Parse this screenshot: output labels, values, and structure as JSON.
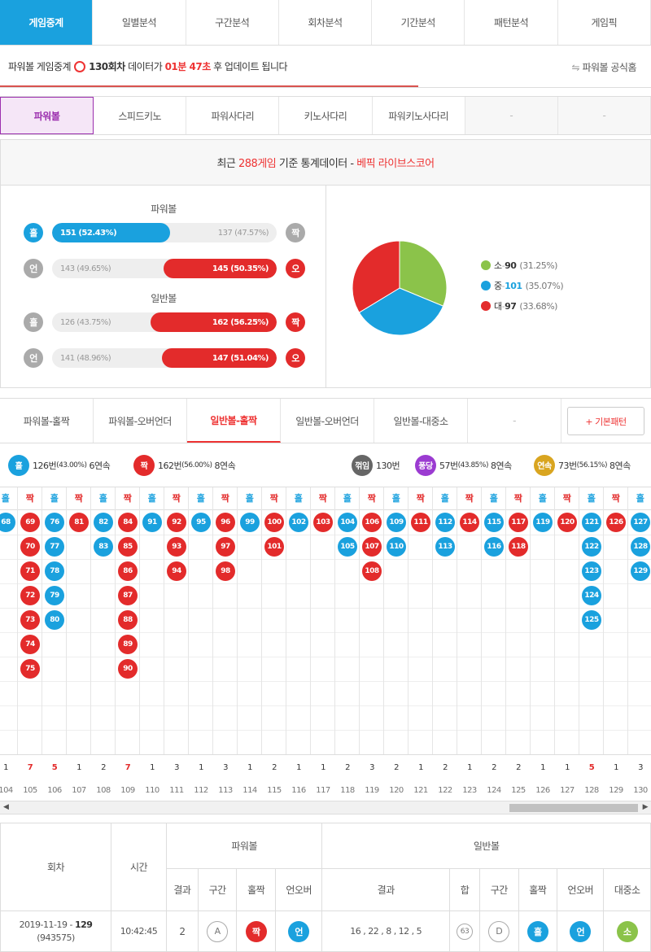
{
  "top_tabs": [
    "게임중계",
    "일별분석",
    "구간분석",
    "회차분석",
    "기간분석",
    "패턴분석",
    "게임픽"
  ],
  "info": {
    "prefix": "파워볼 게임중계",
    "round": "130회차",
    "mid": "데이터가",
    "time": "01분 47초",
    "suffix": "후 업데이트 됩니다",
    "official": "파워볼 공식홈"
  },
  "game_tabs": [
    "파워볼",
    "스피드키노",
    "파워사다리",
    "키노사다리",
    "파워키노사다리",
    "-",
    "-"
  ],
  "stats": {
    "head_prefix": "최근",
    "head_count": "288게임",
    "head_mid": "기준 통계데이터 -",
    "head_source": "베픽 라이브스코어",
    "powerball_title": "파워볼",
    "normal_title": "일반볼",
    "rows": [
      {
        "left": "홀",
        "right": "짝",
        "left_text": "151 (52.43%)",
        "right_text": "137 (47.57%)",
        "win": "left",
        "pct": 52.43
      },
      {
        "left": "언",
        "right": "오",
        "left_text": "143 (49.65%)",
        "right_text": "145 (50.35%)",
        "win": "right",
        "pct": 50.35
      },
      {
        "left": "홀",
        "right": "짝",
        "left_text": "126 (43.75%)",
        "right_text": "162 (56.25%)",
        "win": "right",
        "pct": 56.25
      },
      {
        "left": "언",
        "right": "오",
        "left_text": "141 (48.96%)",
        "right_text": "147 (51.04%)",
        "win": "right",
        "pct": 51.04
      }
    ],
    "pie": [
      {
        "label": "소",
        "value": "90",
        "pct": "(31.25%)",
        "num": 31.25,
        "color": "#8bc34a"
      },
      {
        "label": "중",
        "value": "101",
        "pct": "(35.07%)",
        "num": 35.07,
        "color": "#1aa1de"
      },
      {
        "label": "대",
        "value": "97",
        "pct": "(33.68%)",
        "num": 33.68,
        "color": "#e32b2b"
      }
    ]
  },
  "sub_tabs": [
    "파워볼-홀짝",
    "파워볼-오버언더",
    "일반볼-홀짝",
    "일반볼-오버언더",
    "일반볼-대중소",
    "-"
  ],
  "add_pattern": "+ 기본패턴",
  "legend": {
    "odd_label": "홀",
    "odd_count": "126번",
    "odd_pct": "(43.00%)",
    "odd_streak": "6연속",
    "even_label": "짝",
    "even_count": "162번",
    "even_pct": "(56.00%)",
    "even_streak": "8연속",
    "broken_label": "꺾임",
    "broken_count": "130번",
    "pong_label": "퐁당",
    "pong_count": "57번",
    "pong_pct": "(43.85%)",
    "pong_streak": "8연속",
    "cont_label": "연속",
    "cont_count": "73번",
    "cont_pct": "(56.15%)",
    "cont_streak": "8연속"
  },
  "columns": [
    {
      "h": "홀",
      "t": "o",
      "b": [
        "68"
      ],
      "c": "1",
      "r": "104"
    },
    {
      "h": "짝",
      "t": "e",
      "b": [
        "69",
        "70",
        "71",
        "72",
        "73",
        "74",
        "75"
      ],
      "c": "7",
      "r": "105"
    },
    {
      "h": "홀",
      "t": "o",
      "b": [
        "76",
        "77",
        "78",
        "79",
        "80"
      ],
      "c": "5",
      "r": "106"
    },
    {
      "h": "짝",
      "t": "e",
      "b": [
        "81"
      ],
      "c": "1",
      "r": "107"
    },
    {
      "h": "홀",
      "t": "o",
      "b": [
        "82",
        "83"
      ],
      "c": "2",
      "r": "108"
    },
    {
      "h": "짝",
      "t": "e",
      "b": [
        "84",
        "85",
        "86",
        "87",
        "88",
        "89",
        "90"
      ],
      "c": "7",
      "r": "109"
    },
    {
      "h": "홀",
      "t": "o",
      "b": [
        "91"
      ],
      "c": "1",
      "r": "110"
    },
    {
      "h": "짝",
      "t": "e",
      "b": [
        "92",
        "93",
        "94"
      ],
      "c": "3",
      "r": "111"
    },
    {
      "h": "홀",
      "t": "o",
      "b": [
        "95"
      ],
      "c": "1",
      "r": "112"
    },
    {
      "h": "짝",
      "t": "e",
      "b": [
        "96",
        "97",
        "98"
      ],
      "c": "3",
      "r": "113"
    },
    {
      "h": "홀",
      "t": "o",
      "b": [
        "99"
      ],
      "c": "1",
      "r": "114"
    },
    {
      "h": "짝",
      "t": "e",
      "b": [
        "100",
        "101"
      ],
      "c": "2",
      "r": "115"
    },
    {
      "h": "홀",
      "t": "o",
      "b": [
        "102"
      ],
      "c": "1",
      "r": "116"
    },
    {
      "h": "짝",
      "t": "e",
      "b": [
        "103"
      ],
      "c": "1",
      "r": "117"
    },
    {
      "h": "홀",
      "t": "o",
      "b": [
        "104",
        "105"
      ],
      "c": "2",
      "r": "118"
    },
    {
      "h": "짝",
      "t": "e",
      "b": [
        "106",
        "107",
        "108"
      ],
      "c": "3",
      "r": "119"
    },
    {
      "h": "홀",
      "t": "o",
      "b": [
        "109",
        "110"
      ],
      "c": "2",
      "r": "120"
    },
    {
      "h": "짝",
      "t": "e",
      "b": [
        "111"
      ],
      "c": "1",
      "r": "121"
    },
    {
      "h": "홀",
      "t": "o",
      "b": [
        "112",
        "113"
      ],
      "c": "2",
      "r": "122"
    },
    {
      "h": "짝",
      "t": "e",
      "b": [
        "114"
      ],
      "c": "1",
      "r": "123"
    },
    {
      "h": "홀",
      "t": "o",
      "b": [
        "115",
        "116"
      ],
      "c": "2",
      "r": "124"
    },
    {
      "h": "짝",
      "t": "e",
      "b": [
        "117",
        "118"
      ],
      "c": "2",
      "r": "125"
    },
    {
      "h": "홀",
      "t": "o",
      "b": [
        "119"
      ],
      "c": "1",
      "r": "126"
    },
    {
      "h": "짝",
      "t": "e",
      "b": [
        "120"
      ],
      "c": "1",
      "r": "127"
    },
    {
      "h": "홀",
      "t": "o",
      "b": [
        "121",
        "122",
        "123",
        "124",
        "125"
      ],
      "c": "5",
      "r": "128"
    },
    {
      "h": "짝",
      "t": "e",
      "b": [
        "126"
      ],
      "c": "1",
      "r": "129"
    },
    {
      "h": "홀",
      "t": "o",
      "b": [
        "127",
        "128",
        "129"
      ],
      "c": "3",
      "r": "130"
    }
  ],
  "result_table": {
    "h_round": "회차",
    "h_time": "시간",
    "h_power": "파워볼",
    "h_normal": "일반볼",
    "sub": [
      "결과",
      "구간",
      "홀짝",
      "언오버",
      "결과",
      "합",
      "구간",
      "홀짝",
      "언오버",
      "대중소"
    ],
    "row": {
      "date": "2019-11-19 -",
      "round": "129",
      "id": "(943575)",
      "time": "10:42:45",
      "p_result": "2",
      "p_range": "A",
      "p_oe": "짝",
      "p_uo": "언",
      "n_result": "16 , 22 , 8 , 12 , 5",
      "n_sum": "63",
      "n_range": "D",
      "n_oe": "홀",
      "n_uo": "언",
      "n_size": "소"
    }
  }
}
